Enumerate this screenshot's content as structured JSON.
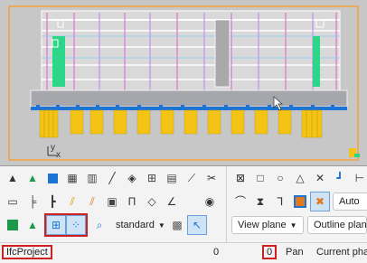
{
  "viewport": {
    "axis_y": "y",
    "axis_x": "x"
  },
  "toolbar": {
    "view_mode": "standard",
    "view_plane": "View plane",
    "outline_plane": "Outline plane",
    "auto_label": "Auto"
  },
  "statusbar": {
    "project_name": "IfcProject",
    "center_value": "0",
    "highlighted_value": "0",
    "pan_label": "Pan",
    "current_phase": "Current pha"
  },
  "colors": {
    "viewport_bg": "#c7c7c7",
    "selection_outline": "#f2a33a",
    "highlight_red": "#d02020",
    "column_yellow": "#f3c316",
    "accent_blue": "#1c74d4",
    "green_block": "#2ed68a"
  }
}
